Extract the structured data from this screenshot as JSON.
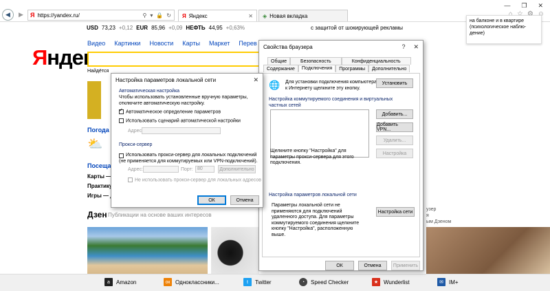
{
  "browser": {
    "url": "https://yandex.ru/",
    "tabs": [
      {
        "label": "Яндекс"
      },
      {
        "label": "Новая вкладка"
      }
    ],
    "window_controls": [
      "—",
      "❐",
      "✕"
    ],
    "toolbar_icons": [
      "home-icon",
      "star-icon",
      "gear-icon",
      "smiley-icon"
    ]
  },
  "yandex": {
    "rates": {
      "usd_label": "USD",
      "usd": "73,23",
      "usd_change": "+0,12",
      "eur_label": "EUR",
      "eur": "85,96",
      "eur_change": "+0,09",
      "oil_label": "НЕФТЬ",
      "oil": "44,95",
      "oil_change": "+0,63%"
    },
    "banner": "с защитой от шокирующей рекламы",
    "logo_first": "Я",
    "logo_rest": "ндекс",
    "services": [
      "Видео",
      "Картинки",
      "Новости",
      "Карты",
      "Маркет",
      "Перев"
    ],
    "found_text": "Найдётся",
    "weather_heading": "Погода",
    "visit_heading": "Посеща",
    "visit_rows": [
      "Карты — р",
      "Практику",
      "Игры — д"
    ],
    "zen_title": "Дзен",
    "zen_subtitle": "Публикации на основе ваших интересов",
    "zen_right": [
      "узер",
      "я",
      "ым Дзеном"
    ],
    "tip_text": "на балконе и в квартире (психологическое наблю-дение)"
  },
  "favorites": [
    {
      "label": "Amazon",
      "icon": "amazon-icon",
      "color": "#222222"
    },
    {
      "label": "Одноклассники...",
      "icon": "odnoklassniki-icon",
      "color": "#ee8208"
    },
    {
      "label": "Twitter",
      "icon": "twitter-icon",
      "color": "#1da1f2"
    },
    {
      "label": "Speed Checker",
      "icon": "speed-checker-icon",
      "color": "#444444"
    },
    {
      "label": "Wunderlist",
      "icon": "wunderlist-icon",
      "color": "#d9301c"
    },
    {
      "label": "IM+",
      "icon": "im-plus-icon",
      "color": "#1f5aa6"
    }
  ],
  "browser_props": {
    "title": "Свойства браузера",
    "help": "?",
    "tabs_row1": [
      "Общие",
      "Безопасность",
      "Конфиденциальность"
    ],
    "tabs_row2": [
      "Содержание",
      "Подключения",
      "Программы",
      "Дополнительно"
    ],
    "setup_text": "Для установки подключения компьютера к Интернету щелкните эту кнопку.",
    "setup_button": "Установить",
    "dialup_group": "Настройка коммутируемого соединения и виртуальных частных сетей",
    "add_button": "Добавить...",
    "add_vpn_button": "Добавить VPN...",
    "remove_button": "Удалить...",
    "settings_text": "Щелкните кнопку \"Настройка\" для параметры прокси-сервера для этого подключения.",
    "settings_button": "Настройка",
    "lan_group": "Настройка параметров локальной сети",
    "lan_text": "Параметры локальной сети не применяются для подключений удаленного доступа. Для параметры коммутируемого соединения щелкните кнопку \"Настройка\", расположенную выше.",
    "lan_button": "Настройка сети",
    "ok": "ОК",
    "cancel": "Отмена",
    "apply": "Применить"
  },
  "lan_dialog": {
    "title": "Настройка параметров локальной сети",
    "auto_group": "Автоматическая настройка",
    "auto_text": "Чтобы использовать установленные вручную параметры, отключите автоматическую настройку.",
    "auto_detect": "Автоматическое определение параметров",
    "auto_detect_checked": true,
    "use_script": "Использовать сценарий автоматической настройки",
    "use_script_checked": false,
    "address_label": "Адрес",
    "proxy_group": "Прокси-сервер",
    "use_proxy": "Использовать прокси-сервер для локальных подключений (не применяется для коммутируемых или VPN-подключений).",
    "use_proxy_checked": false,
    "proxy_address_label": "Адрес:",
    "port_label": "Порт:",
    "port_value": "80",
    "advanced_button": "Дополнительно",
    "bypass_local": "Не использовать прокси-сервер для локальных адресов",
    "ok": "ОК",
    "cancel": "Отмена",
    "close": "✕"
  }
}
